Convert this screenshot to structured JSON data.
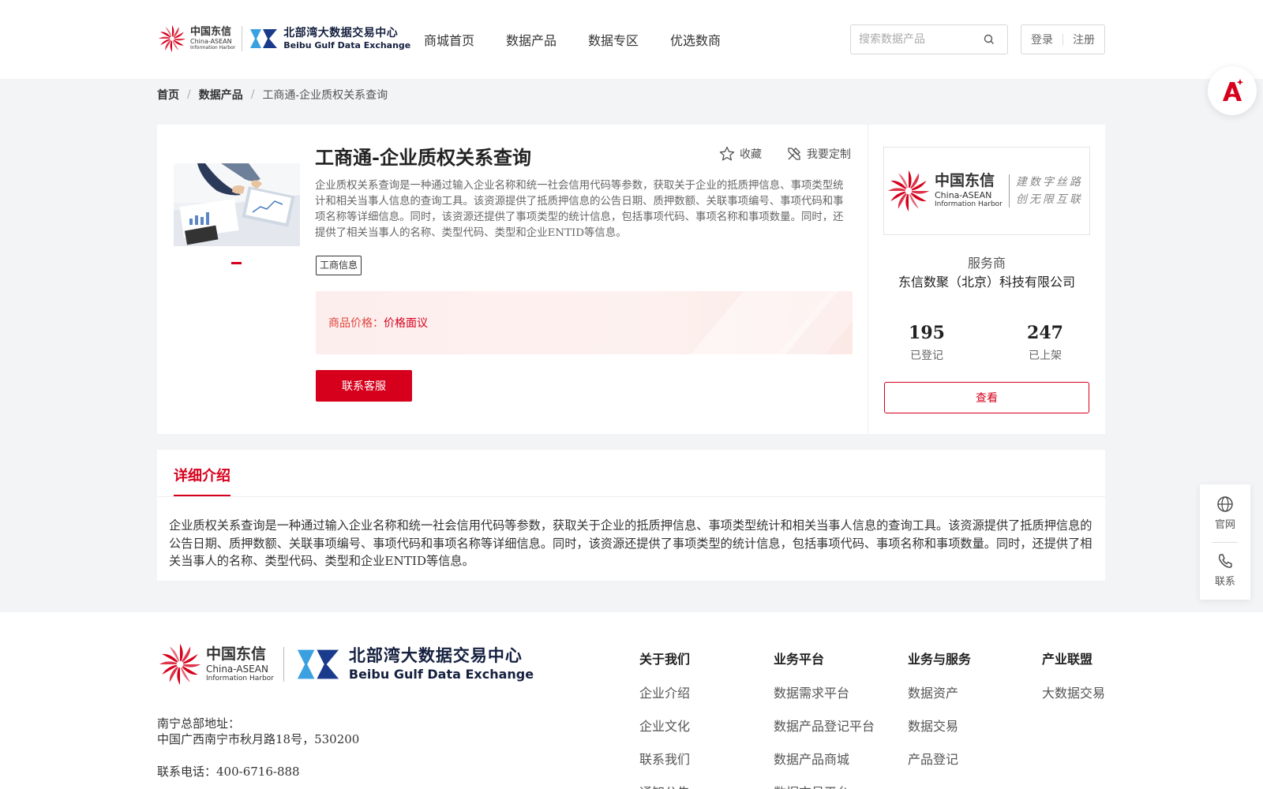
{
  "header": {
    "logo_cn": "中国东信",
    "logo_en": "China-ASEAN",
    "logo_en2": "Information Harbor",
    "exchange_cn": "北部湾大数据交易中心",
    "exchange_en": "Beibu Gulf Data Exchange",
    "nav": [
      "商城首页",
      "数据产品",
      "数据专区",
      "优选数商"
    ],
    "search_placeholder": "搜索数据产品",
    "login": "登录",
    "register": "注册"
  },
  "breadcrumb": {
    "home": "首页",
    "products": "数据产品",
    "current": "工商通-企业质权关系查询",
    "separator": "/"
  },
  "product": {
    "title": "工商通-企业质权关系查询",
    "favorite": "收藏",
    "customize": "我要定制",
    "description": "企业质权关系查询是一种通过输入企业名称和统一社会信用代码等参数，获取关于企业的抵质押信息、事项类型统计和相关当事人信息的查询工具。该资源提供了抵质押信息的公告日期、质押数额、关联事项编号、事项代码和事项名称等详细信息。同时，该资源还提供了事项类型的统计信息，包括事项代码、事项名称和事项数量。同时，还提供了相关当事人的名称、类型代码、类型和企业ENTID等信息。",
    "tag": "工商信息",
    "price_label": "商品价格：",
    "price_value": "价格面议",
    "contact_button": "联系客服"
  },
  "provider": {
    "logo_cn": "中国东信",
    "logo_en": "China-ASEAN",
    "logo_en2": "Information Harbor",
    "slogan_line1": "建数字丝路",
    "slogan_line2": "创无限互联",
    "label": "服务商",
    "name": "东信数聚（北京）科技有限公司",
    "registered_count": "195",
    "registered_label": "已登记",
    "listed_count": "247",
    "listed_label": "已上架",
    "view_button": "查看"
  },
  "detail": {
    "tab": "详细介绍",
    "text": "企业质权关系查询是一种通过输入企业名称和统一社会信用代码等参数，获取关于企业的抵质押信息、事项类型统计和相关当事人信息的查询工具。该资源提供了抵质押信息的公告日期、质押数额、关联事项编号、事项代码和事项名称等详细信息。同时，该资源还提供了事项类型的统计信息，包括事项代码、事项名称和事项数量。同时，还提供了相关当事人的名称、类型代码、类型和企业ENTID等信息。"
  },
  "side_panel": {
    "website": "官网",
    "contact": "联系"
  },
  "footer": {
    "address_label": "南宁总部地址：",
    "address": "中国广西南宁市秋月路18号，530200",
    "phone": "联系电话：400-6716-888",
    "columns": [
      {
        "head": "关于我们",
        "links": [
          "企业介绍",
          "企业文化",
          "联系我们",
          "通知公告"
        ]
      },
      {
        "head": "业务平台",
        "links": [
          "数据需求平台",
          "数据产品登记平台",
          "数据产品商城",
          "数据交易平台"
        ]
      },
      {
        "head": "业务与服务",
        "links": [
          "数据资产",
          "数据交易",
          "产品登记"
        ]
      },
      {
        "head": "产业联盟",
        "links": [
          "大数据交易"
        ]
      }
    ]
  },
  "colors": {
    "brand_red": "#d6001c",
    "price_red": "#e0453c",
    "exchange_blue": "#3aa0e0",
    "background_gray": "#f3f4f6"
  }
}
